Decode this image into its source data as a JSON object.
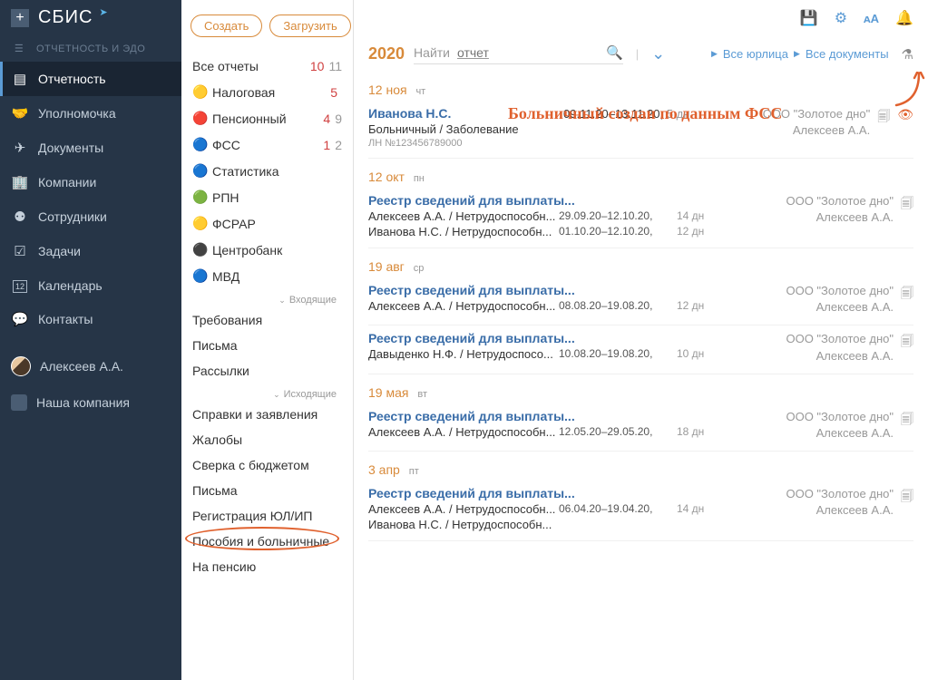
{
  "header": {
    "logo": "СБИС",
    "subtitle": "ОТЧЕТНОСТЬ И ЭДО"
  },
  "nav": [
    {
      "label": "Отчетность",
      "icon": "doc-check"
    },
    {
      "label": "Уполномочка",
      "icon": "handshake"
    },
    {
      "label": "Документы",
      "icon": "send"
    },
    {
      "label": "Компании",
      "icon": "buildings"
    },
    {
      "label": "Сотрудники",
      "icon": "users"
    },
    {
      "label": "Задачи",
      "icon": "check-square"
    },
    {
      "label": "Календарь",
      "icon": "calendar"
    },
    {
      "label": "Контакты",
      "icon": "chat"
    }
  ],
  "user": {
    "name": "Алексеев А.А."
  },
  "company": {
    "label": "Наша компания"
  },
  "actions": {
    "create": "Создать",
    "upload": "Загрузить"
  },
  "reportCategories": {
    "header": {
      "label": "Все отчеты",
      "red": "10",
      "gray": "11"
    },
    "items": [
      {
        "label": "Налоговая",
        "red": "5",
        "gray": ""
      },
      {
        "label": "Пенсионный",
        "red": "4",
        "gray": "9"
      },
      {
        "label": "ФСС",
        "red": "1",
        "gray": "2"
      },
      {
        "label": "Статистика",
        "red": "",
        "gray": ""
      },
      {
        "label": "РПН",
        "red": "",
        "gray": ""
      },
      {
        "label": "ФСРАР",
        "red": "",
        "gray": ""
      },
      {
        "label": "Центробанк",
        "red": "",
        "gray": ""
      },
      {
        "label": "МВД",
        "red": "",
        "gray": ""
      }
    ],
    "group1": "Входящие",
    "incoming": [
      "Требования",
      "Письма",
      "Рассылки"
    ],
    "group2": "Исходящие",
    "outgoing": [
      "Справки и заявления",
      "Жалобы",
      "Сверка с бюджетом",
      "Письма",
      "Регистрация ЮЛ/ИП",
      "Пособия и больничные",
      "На пенсию"
    ]
  },
  "searchArea": {
    "year": "2020",
    "searchPrefix": "Найти",
    "searchPlaceholder": "отчет",
    "filterAll": "Все юрлица",
    "filterDocs": "Все документы"
  },
  "annotation": "Больничный создан по данным ФСС",
  "dateGroups": [
    {
      "date": "12 ноя",
      "weekday": "чт"
    },
    {
      "date": "12 окт",
      "weekday": "пн"
    },
    {
      "date": "19 авг",
      "weekday": "ср"
    },
    {
      "date": "19 мая",
      "weekday": "вт"
    },
    {
      "date": "3 апр",
      "weekday": "пт"
    }
  ],
  "docs": {
    "d1": {
      "title": "Иванова Н.С.",
      "line1": "Больничный / Заболевание",
      "meta": "ЛН №123456789000",
      "period": "09.11.20–13.11.20,",
      "days": "5 дн",
      "org": "ООО \"Золотое дно\"",
      "person": "Алексеев А.А."
    },
    "d2": {
      "title": "Реестр сведений для выплаты...",
      "lines": [
        {
          "name": "Алексеев А.А. / Нетрудоспособн...",
          "period": "29.09.20–12.10.20,",
          "days": "14 дн"
        },
        {
          "name": "Иванова Н.С. / Нетрудоспособн...",
          "period": "01.10.20–12.10.20,",
          "days": "12 дн"
        }
      ],
      "org": "ООО \"Золотое дно\"",
      "person": "Алексеев А.А."
    },
    "d3": {
      "title": "Реестр сведений для выплаты...",
      "lines": [
        {
          "name": "Алексеев А.А. / Нетрудоспособн...",
          "period": "08.08.20–19.08.20,",
          "days": "12 дн"
        }
      ],
      "org": "ООО \"Золотое дно\"",
      "person": "Алексеев А.А."
    },
    "d4": {
      "title": "Реестр сведений для выплаты...",
      "lines": [
        {
          "name": "Давыденко Н.Ф. / Нетрудоспосо...",
          "period": "10.08.20–19.08.20,",
          "days": "10 дн"
        }
      ],
      "org": "ООО \"Золотое дно\"",
      "person": "Алексеев А.А."
    },
    "d5": {
      "title": "Реестр сведений для выплаты...",
      "lines": [
        {
          "name": "Алексеев А.А. / Нетрудоспособн...",
          "period": "12.05.20–29.05.20,",
          "days": "18 дн"
        }
      ],
      "org": "ООО \"Золотое дно\"",
      "person": "Алексеев А.А."
    },
    "d6": {
      "title": "Реестр сведений для выплаты...",
      "lines": [
        {
          "name": "Алексеев А.А. / Нетрудоспособн...",
          "period": "06.04.20–19.04.20,",
          "days": "14 дн"
        },
        {
          "name": "Иванова Н.С. / Нетрудоспособн...",
          "period": "",
          "days": ""
        }
      ],
      "org": "ООО \"Золотое дно\"",
      "person": "Алексеев А.А."
    }
  }
}
